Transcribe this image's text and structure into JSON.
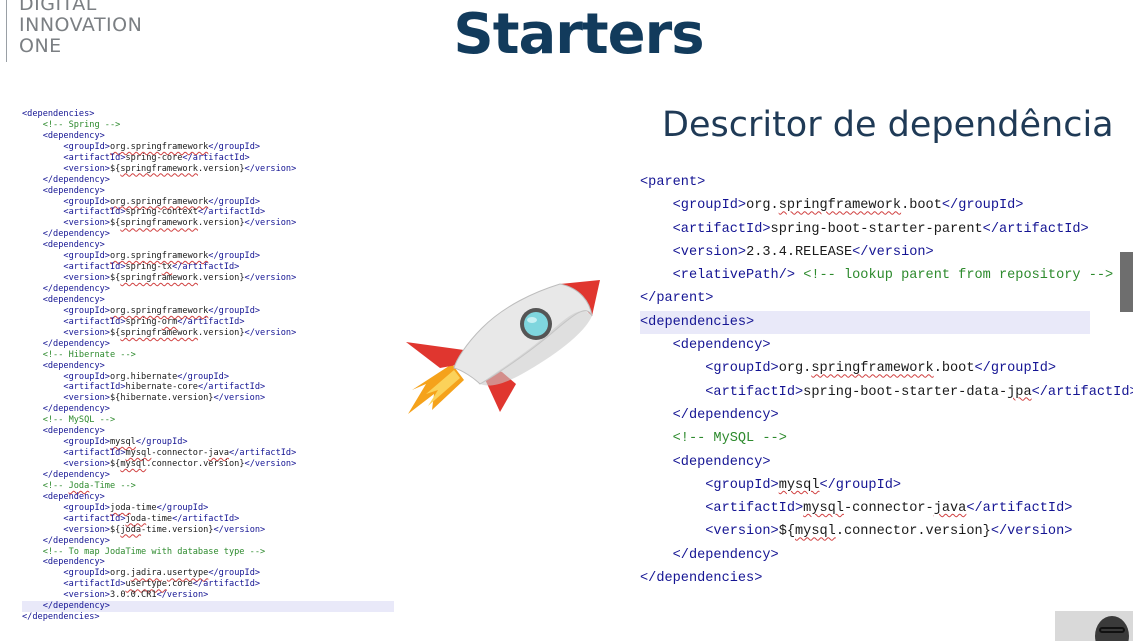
{
  "logo": {
    "lines": [
      "DIGITAL",
      "INNOVATION",
      "ONE"
    ]
  },
  "title": "Starters",
  "subtitle": "Descritor de dependência",
  "left_code": [
    [
      {
        "k": "t",
        "v": "<dependencies>"
      }
    ],
    [
      {
        "k": "p",
        "v": "    "
      },
      {
        "k": "c",
        "v": "<!-- Spring -->"
      }
    ],
    [
      {
        "k": "p",
        "v": "    "
      },
      {
        "k": "t",
        "v": "<dependency>"
      }
    ],
    [
      {
        "k": "p",
        "v": "        "
      },
      {
        "k": "t",
        "v": "<groupId>"
      },
      {
        "k": "s",
        "v": "org.springframework"
      },
      {
        "k": "t",
        "v": "</groupId>"
      }
    ],
    [
      {
        "k": "p",
        "v": "        "
      },
      {
        "k": "t",
        "v": "<artifactId>"
      },
      {
        "k": "p",
        "v": "spring-core"
      },
      {
        "k": "t",
        "v": "</artifactId>"
      }
    ],
    [
      {
        "k": "p",
        "v": "        "
      },
      {
        "k": "t",
        "v": "<version>"
      },
      {
        "k": "p",
        "v": "${"
      },
      {
        "k": "s",
        "v": "springframework"
      },
      {
        "k": "p",
        "v": ".version}"
      },
      {
        "k": "t",
        "v": "</version>"
      }
    ],
    [
      {
        "k": "p",
        "v": "    "
      },
      {
        "k": "t",
        "v": "</dependency>"
      }
    ],
    [
      {
        "k": "p",
        "v": "    "
      },
      {
        "k": "t",
        "v": "<dependency>"
      }
    ],
    [
      {
        "k": "p",
        "v": "        "
      },
      {
        "k": "t",
        "v": "<groupId>"
      },
      {
        "k": "s",
        "v": "org.springframework"
      },
      {
        "k": "t",
        "v": "</groupId>"
      }
    ],
    [
      {
        "k": "p",
        "v": "        "
      },
      {
        "k": "t",
        "v": "<artifactId>"
      },
      {
        "k": "p",
        "v": "spring-context"
      },
      {
        "k": "t",
        "v": "</artifactId>"
      }
    ],
    [
      {
        "k": "p",
        "v": "        "
      },
      {
        "k": "t",
        "v": "<version>"
      },
      {
        "k": "p",
        "v": "${"
      },
      {
        "k": "s",
        "v": "springframework"
      },
      {
        "k": "p",
        "v": ".version}"
      },
      {
        "k": "t",
        "v": "</version>"
      }
    ],
    [
      {
        "k": "p",
        "v": "    "
      },
      {
        "k": "t",
        "v": "</dependency>"
      }
    ],
    [
      {
        "k": "p",
        "v": "    "
      },
      {
        "k": "t",
        "v": "<dependency>"
      }
    ],
    [
      {
        "k": "p",
        "v": "        "
      },
      {
        "k": "t",
        "v": "<groupId>"
      },
      {
        "k": "s",
        "v": "org.springframework"
      },
      {
        "k": "t",
        "v": "</groupId>"
      }
    ],
    [
      {
        "k": "p",
        "v": "        "
      },
      {
        "k": "t",
        "v": "<artifactId>"
      },
      {
        "k": "p",
        "v": "spring-"
      },
      {
        "k": "s",
        "v": "tx"
      },
      {
        "k": "t",
        "v": "</artifactId>"
      }
    ],
    [
      {
        "k": "p",
        "v": "        "
      },
      {
        "k": "t",
        "v": "<version>"
      },
      {
        "k": "p",
        "v": "${"
      },
      {
        "k": "s",
        "v": "springframework"
      },
      {
        "k": "p",
        "v": ".version}"
      },
      {
        "k": "t",
        "v": "</version>"
      }
    ],
    [
      {
        "k": "p",
        "v": "    "
      },
      {
        "k": "t",
        "v": "</dependency>"
      }
    ],
    [
      {
        "k": "p",
        "v": "    "
      },
      {
        "k": "t",
        "v": "<dependency>"
      }
    ],
    [
      {
        "k": "p",
        "v": "        "
      },
      {
        "k": "t",
        "v": "<groupId>"
      },
      {
        "k": "s",
        "v": "org.springframework"
      },
      {
        "k": "t",
        "v": "</groupId>"
      }
    ],
    [
      {
        "k": "p",
        "v": "        "
      },
      {
        "k": "t",
        "v": "<artifactId>"
      },
      {
        "k": "p",
        "v": "spring-"
      },
      {
        "k": "s",
        "v": "orm"
      },
      {
        "k": "t",
        "v": "</artifactId>"
      }
    ],
    [
      {
        "k": "p",
        "v": "        "
      },
      {
        "k": "t",
        "v": "<version>"
      },
      {
        "k": "p",
        "v": "${"
      },
      {
        "k": "s",
        "v": "springframework"
      },
      {
        "k": "p",
        "v": ".version}"
      },
      {
        "k": "t",
        "v": "</version>"
      }
    ],
    [
      {
        "k": "p",
        "v": "    "
      },
      {
        "k": "t",
        "v": "</dependency>"
      }
    ],
    [
      {
        "k": "p",
        "v": "    "
      },
      {
        "k": "c",
        "v": "<!-- Hibernate -->"
      }
    ],
    [
      {
        "k": "p",
        "v": "    "
      },
      {
        "k": "t",
        "v": "<dependency>"
      }
    ],
    [
      {
        "k": "p",
        "v": "        "
      },
      {
        "k": "t",
        "v": "<groupId>"
      },
      {
        "k": "p",
        "v": "org.hibernate"
      },
      {
        "k": "t",
        "v": "</groupId>"
      }
    ],
    [
      {
        "k": "p",
        "v": "        "
      },
      {
        "k": "t",
        "v": "<artifactId>"
      },
      {
        "k": "p",
        "v": "hibernate-core"
      },
      {
        "k": "t",
        "v": "</artifactId>"
      }
    ],
    [
      {
        "k": "p",
        "v": "        "
      },
      {
        "k": "t",
        "v": "<version>"
      },
      {
        "k": "p",
        "v": "${hibernate.version}"
      },
      {
        "k": "t",
        "v": "</version>"
      }
    ],
    [
      {
        "k": "p",
        "v": "    "
      },
      {
        "k": "t",
        "v": "</dependency>"
      }
    ],
    [
      {
        "k": "p",
        "v": "    "
      },
      {
        "k": "c",
        "v": "<!-- MySQL -->"
      }
    ],
    [
      {
        "k": "p",
        "v": "    "
      },
      {
        "k": "t",
        "v": "<dependency>"
      }
    ],
    [
      {
        "k": "p",
        "v": "        "
      },
      {
        "k": "t",
        "v": "<groupId>"
      },
      {
        "k": "s",
        "v": "mysql"
      },
      {
        "k": "t",
        "v": "</groupId>"
      }
    ],
    [
      {
        "k": "p",
        "v": "        "
      },
      {
        "k": "t",
        "v": "<artifactId>"
      },
      {
        "k": "s",
        "v": "mysql"
      },
      {
        "k": "p",
        "v": "-connector-"
      },
      {
        "k": "s",
        "v": "java"
      },
      {
        "k": "t",
        "v": "</artifactId>"
      }
    ],
    [
      {
        "k": "p",
        "v": "        "
      },
      {
        "k": "t",
        "v": "<version>"
      },
      {
        "k": "p",
        "v": "${"
      },
      {
        "k": "s",
        "v": "mysql"
      },
      {
        "k": "p",
        "v": ".connector.version}"
      },
      {
        "k": "t",
        "v": "</version>"
      }
    ],
    [
      {
        "k": "p",
        "v": "    "
      },
      {
        "k": "t",
        "v": "</dependency>"
      }
    ],
    [
      {
        "k": "p",
        "v": "    "
      },
      {
        "k": "c",
        "v": "<!-- "
      },
      {
        "k": "cs",
        "v": "Joda"
      },
      {
        "k": "c",
        "v": "-Time -->"
      }
    ],
    [
      {
        "k": "p",
        "v": "    "
      },
      {
        "k": "t",
        "v": "<dependency>"
      }
    ],
    [
      {
        "k": "p",
        "v": "        "
      },
      {
        "k": "t",
        "v": "<groupId>"
      },
      {
        "k": "s",
        "v": "joda"
      },
      {
        "k": "p",
        "v": "-time"
      },
      {
        "k": "t",
        "v": "</groupId>"
      }
    ],
    [
      {
        "k": "p",
        "v": "        "
      },
      {
        "k": "t",
        "v": "<artifactId>"
      },
      {
        "k": "s",
        "v": "joda"
      },
      {
        "k": "p",
        "v": "-time"
      },
      {
        "k": "t",
        "v": "</artifactId>"
      }
    ],
    [
      {
        "k": "p",
        "v": "        "
      },
      {
        "k": "t",
        "v": "<version>"
      },
      {
        "k": "p",
        "v": "${"
      },
      {
        "k": "s",
        "v": "joda"
      },
      {
        "k": "p",
        "v": "-time.version}"
      },
      {
        "k": "t",
        "v": "</version>"
      }
    ],
    [
      {
        "k": "p",
        "v": "    "
      },
      {
        "k": "t",
        "v": "</dependency>"
      }
    ],
    [
      {
        "k": "p",
        "v": "    "
      },
      {
        "k": "c",
        "v": "<!-- To map JodaTime with database type -->"
      }
    ],
    [
      {
        "k": "p",
        "v": "    "
      },
      {
        "k": "t",
        "v": "<dependency>"
      }
    ],
    [
      {
        "k": "p",
        "v": "        "
      },
      {
        "k": "t",
        "v": "<groupId>"
      },
      {
        "k": "p",
        "v": "org."
      },
      {
        "k": "s",
        "v": "jadira"
      },
      {
        "k": "p",
        "v": "."
      },
      {
        "k": "s",
        "v": "usertype"
      },
      {
        "k": "t",
        "v": "</groupId>"
      }
    ],
    [
      {
        "k": "p",
        "v": "        "
      },
      {
        "k": "t",
        "v": "<artifactId>"
      },
      {
        "k": "s",
        "v": "usertype"
      },
      {
        "k": "p",
        "v": ".core"
      },
      {
        "k": "t",
        "v": "</artifactId>"
      }
    ],
    [
      {
        "k": "p",
        "v": "        "
      },
      {
        "k": "t",
        "v": "<version>"
      },
      {
        "k": "p",
        "v": "3.0.0.CR1"
      },
      {
        "k": "t",
        "v": "</version>"
      }
    ],
    [
      {
        "k": "p",
        "v": "    "
      },
      {
        "k": "t",
        "v": "</dependency>"
      }
    ],
    [
      {
        "k": "t",
        "v": "</dependencies>"
      }
    ]
  ],
  "left_highlight_line": 45,
  "right_code": [
    [
      {
        "k": "t",
        "v": "<parent>"
      }
    ],
    [
      {
        "k": "p",
        "v": "    "
      },
      {
        "k": "t",
        "v": "<groupId>"
      },
      {
        "k": "p",
        "v": "org."
      },
      {
        "k": "s",
        "v": "springframework"
      },
      {
        "k": "p",
        "v": ".boot"
      },
      {
        "k": "t",
        "v": "</groupId>"
      }
    ],
    [
      {
        "k": "p",
        "v": "    "
      },
      {
        "k": "t",
        "v": "<artifactId>"
      },
      {
        "k": "p",
        "v": "spring-boot-starter-parent"
      },
      {
        "k": "t",
        "v": "</artifactId>"
      }
    ],
    [
      {
        "k": "p",
        "v": "    "
      },
      {
        "k": "t",
        "v": "<version>"
      },
      {
        "k": "p",
        "v": "2.3.4.RELEASE"
      },
      {
        "k": "t",
        "v": "</version>"
      }
    ],
    [
      {
        "k": "p",
        "v": "    "
      },
      {
        "k": "t",
        "v": "<relativePath/>"
      },
      {
        "k": "p",
        "v": " "
      },
      {
        "k": "c",
        "v": "<!-- lookup parent from repository -->"
      }
    ],
    [
      {
        "k": "t",
        "v": "</parent>"
      }
    ],
    [
      {
        "k": "t",
        "v": "<dependencies>"
      }
    ],
    [
      {
        "k": "p",
        "v": "    "
      },
      {
        "k": "t",
        "v": "<dependency>"
      }
    ],
    [
      {
        "k": "p",
        "v": "        "
      },
      {
        "k": "t",
        "v": "<groupId>"
      },
      {
        "k": "p",
        "v": "org."
      },
      {
        "k": "s",
        "v": "springframework"
      },
      {
        "k": "p",
        "v": ".boot"
      },
      {
        "k": "t",
        "v": "</groupId>"
      }
    ],
    [
      {
        "k": "p",
        "v": "        "
      },
      {
        "k": "t",
        "v": "<artifactId>"
      },
      {
        "k": "p",
        "v": "spring-boot-starter-data-"
      },
      {
        "k": "s",
        "v": "jpa"
      },
      {
        "k": "t",
        "v": "</artifactId>"
      }
    ],
    [
      {
        "k": "p",
        "v": "    "
      },
      {
        "k": "t",
        "v": "</dependency>"
      }
    ],
    [
      {
        "k": "p",
        "v": "    "
      },
      {
        "k": "c",
        "v": "<!-- MySQL -->"
      }
    ],
    [
      {
        "k": "p",
        "v": "    "
      },
      {
        "k": "t",
        "v": "<dependency>"
      }
    ],
    [
      {
        "k": "p",
        "v": "        "
      },
      {
        "k": "t",
        "v": "<groupId>"
      },
      {
        "k": "s",
        "v": "mysql"
      },
      {
        "k": "t",
        "v": "</groupId>"
      }
    ],
    [
      {
        "k": "p",
        "v": "        "
      },
      {
        "k": "t",
        "v": "<artifactId>"
      },
      {
        "k": "s",
        "v": "mysql"
      },
      {
        "k": "p",
        "v": "-connector-"
      },
      {
        "k": "s",
        "v": "java"
      },
      {
        "k": "t",
        "v": "</artifactId>"
      }
    ],
    [
      {
        "k": "p",
        "v": "        "
      },
      {
        "k": "t",
        "v": "<version>"
      },
      {
        "k": "p",
        "v": "${"
      },
      {
        "k": "s",
        "v": "mysql"
      },
      {
        "k": "p",
        "v": ".connector.version}"
      },
      {
        "k": "t",
        "v": "</version>"
      }
    ],
    [
      {
        "k": "p",
        "v": "    "
      },
      {
        "k": "t",
        "v": "</dependency>"
      }
    ],
    [
      {
        "k": "t",
        "v": "</dependencies>"
      }
    ]
  ],
  "right_highlight_line": 6,
  "colors": {
    "title": "#123b5c",
    "tag": "#141493",
    "comment": "#2d8a2d",
    "rocket_body": "#e8e8e8",
    "rocket_fin": "#e0362f",
    "rocket_window": "#7fd6de",
    "flame": "#f5a21b"
  },
  "icons": {
    "rocket": "rocket-illustration"
  }
}
